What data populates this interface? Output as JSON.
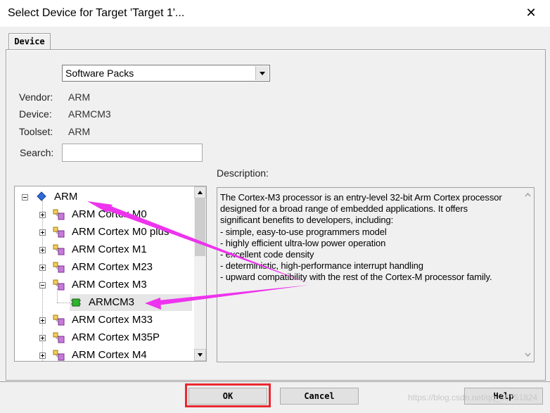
{
  "window": {
    "title": "Select Device for Target 'Target 1'...",
    "close_glyph": "✕"
  },
  "tab": {
    "label": "Device"
  },
  "combo": {
    "value": "Software Packs"
  },
  "fields": {
    "vendor_label": "Vendor:",
    "vendor_value": "ARM",
    "device_label": "Device:",
    "device_value": "ARMCM3",
    "toolset_label": "Toolset:",
    "toolset_value": "ARM",
    "search_label": "Search:",
    "search_value": ""
  },
  "description": {
    "label": "Description:",
    "text": "The Cortex-M3 processor is an entry-level 32-bit Arm Cortex processor\ndesigned for a broad range of embedded applications. It offers\nsignificant benefits to developers, including:\n- simple, easy-to-use programmers model\n- highly efficient ultra-low power operation\n- excellent code density\n- deterministic, high-performance interrupt handling\n- upward compatibility with the rest of the Cortex-M processor family."
  },
  "tree": {
    "root": "ARM",
    "items": [
      "ARM Cortex M0",
      "ARM Cortex M0 plus",
      "ARM Cortex M1",
      "ARM Cortex M23",
      "ARM Cortex M3",
      "ARMCM3",
      "ARM Cortex M33",
      "ARM Cortex M35P",
      "ARM Cortex M4"
    ]
  },
  "buttons": {
    "ok": "OK",
    "cancel": "Cancel",
    "help": "Help"
  },
  "watermark": "https://blog.csdn.net/qq_38751824",
  "colors": {
    "annotation_arrow": "#ee33ee",
    "highlight_box": "#e8292f",
    "selection": "#e6e6e6"
  },
  "icons": {
    "vendor_node": "diamond-blue-icon",
    "family_node": "chip-family-icon",
    "device_node": "green-chip-icon"
  }
}
